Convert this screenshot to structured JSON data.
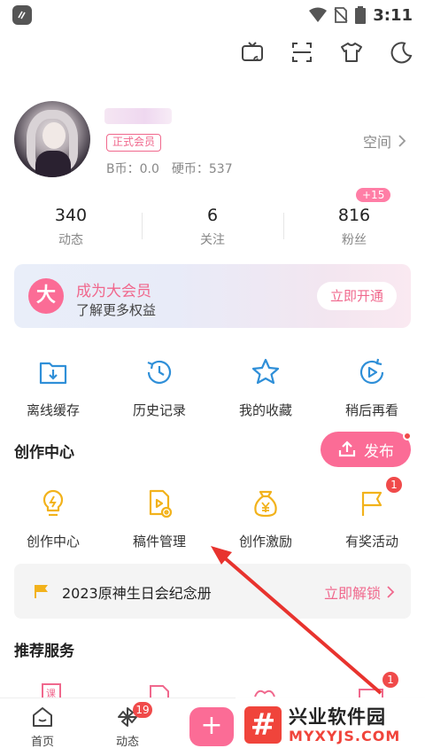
{
  "status_bar": {
    "time": "3:11"
  },
  "profile": {
    "member_tag": "正式会员",
    "b_coin_label": "B币：",
    "b_coin_value": "0.0",
    "hard_coin_label": "硬币：",
    "hard_coin_value": "537",
    "space_label": "空间"
  },
  "stats": [
    {
      "value": "340",
      "label": "动态"
    },
    {
      "value": "6",
      "label": "关注"
    },
    {
      "value": "816",
      "label": "粉丝",
      "badge": "+15"
    }
  ],
  "vip": {
    "icon_char": "大",
    "title": "成为大会员",
    "subtitle": "了解更多权益",
    "button": "立即开通"
  },
  "quick_actions": [
    {
      "label": "离线缓存",
      "icon": "download-folder-icon"
    },
    {
      "label": "历史记录",
      "icon": "history-clock-icon"
    },
    {
      "label": "我的收藏",
      "icon": "star-icon"
    },
    {
      "label": "稍后再看",
      "icon": "watch-later-icon"
    }
  ],
  "creation": {
    "title": "创作中心",
    "publish_button": "发布",
    "items": [
      {
        "label": "创作中心",
        "icon": "lightbulb-icon"
      },
      {
        "label": "稿件管理",
        "icon": "manuscript-icon"
      },
      {
        "label": "创作激励",
        "icon": "money-bag-icon"
      },
      {
        "label": "有奖活动",
        "icon": "flag-icon",
        "badge": "1"
      }
    ]
  },
  "promo": {
    "text": "2023原神生日会纪念册",
    "action": "立即解锁"
  },
  "services": {
    "title": "推荐服务",
    "badge": "1"
  },
  "bottom_nav": {
    "home": "首页",
    "feed": "动态",
    "feed_badge": "19",
    "plus": "+"
  },
  "watermark": {
    "logo": "#",
    "title": "兴业软件园",
    "url": "MYXYJS.COM"
  },
  "colors": {
    "accent": "#fb6c96",
    "accent_text": "#f0688d",
    "icon_blue": "#2f8fd8",
    "icon_yellow": "#f2b21b",
    "badge_red": "#f04a4a"
  }
}
